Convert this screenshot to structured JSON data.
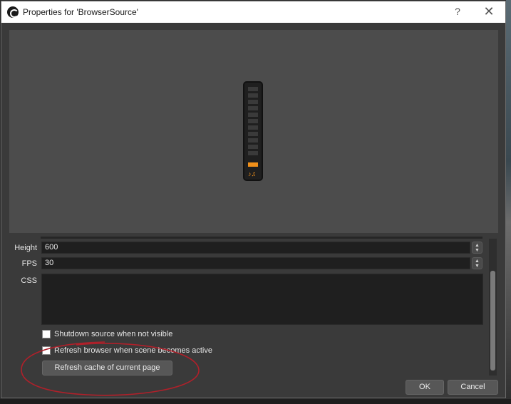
{
  "window": {
    "title": "Properties for 'BrowserSource'",
    "help": "?",
    "close": "✕"
  },
  "fields": {
    "height": {
      "label": "Height",
      "value": "600"
    },
    "fps": {
      "label": "FPS",
      "value": "30"
    },
    "css": {
      "label": "CSS",
      "value": ""
    }
  },
  "checkboxes": {
    "shutdown": {
      "label": "Shutdown source when not visible",
      "checked": false
    },
    "refresh": {
      "label": "Refresh browser when scene becomes active",
      "checked": false
    }
  },
  "buttons": {
    "refresh_cache": "Refresh cache of current page",
    "ok": "OK",
    "cancel": "Cancel"
  },
  "preview": {
    "meter_notes": "♪♫"
  },
  "colors": {
    "accent": "#f0901a",
    "annotation": "#b0202a"
  }
}
